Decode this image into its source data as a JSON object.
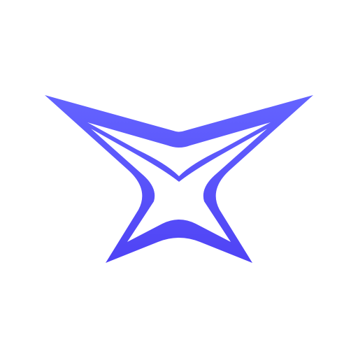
{
  "app": {
    "name": "",
    "icon": "x-star-logo-icon"
  },
  "colors": {
    "background": "#ffffff",
    "logo_light": "#6464ff",
    "logo_dark": "#4f43f5"
  }
}
